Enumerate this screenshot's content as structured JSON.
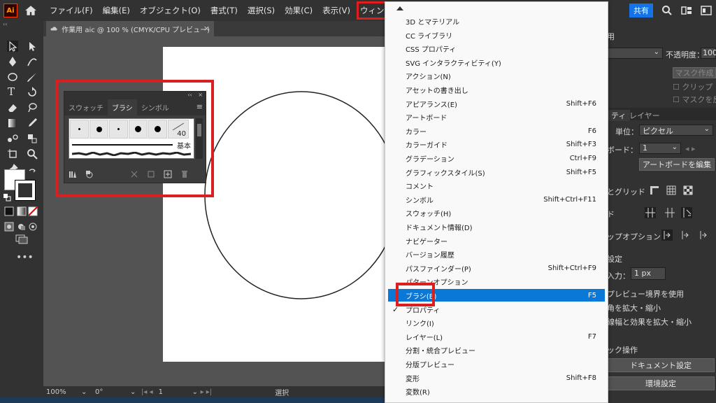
{
  "menubar": {
    "logo": "Ai",
    "items": [
      "ファイル(F)",
      "編集(E)",
      "オブジェクト(O)",
      "書式(T)",
      "選択(S)",
      "効果(C)",
      "表示(V)",
      "ウィンドウ(W)"
    ],
    "share": "共有"
  },
  "document": {
    "tab_label": "作業用 aic @ 100 % (CMYK/CPU プレビュー)",
    "close": "×"
  },
  "brush_panel": {
    "collapse": "‹‹",
    "close": "×",
    "tabs": [
      "スウォッチ",
      "ブラシ",
      "シンボル"
    ],
    "menu": "≡",
    "size_label": "40",
    "basic_label": "基本"
  },
  "statusbar": {
    "zoom": "100%",
    "rotation": "0°",
    "artboard": "1",
    "mode": "選択"
  },
  "right_panel": {
    "tab_top": "用",
    "opacity_label": "不透明度：",
    "opacity_value": "100",
    "mask_btn": "マスク作成",
    "clip_label": "クリップ",
    "invert_label": "マスクを反",
    "tab_props": "ティ",
    "tab_layers": "レイヤー",
    "unit_label": "単位：",
    "unit_value": "ピクセル",
    "artboard_label": "ボード：",
    "artboard_value": "1",
    "edit_artboard_btn": "アートボードを編集",
    "guide_label": "とグリッド",
    "snap_label": "ド",
    "snap_options_label": "ップオプション",
    "prefs_label": "設定",
    "input_label": "入力：",
    "input_value": "1 px",
    "preview_bounds": "プレビュー境界を使用",
    "scale_corners": "角を拡大・縮小",
    "scale_strokes": "線幅と効果を拡大・縮小",
    "quick_ops": "ック操作",
    "doc_settings_btn": "ドキュメント設定",
    "env_settings_btn": "環境設定"
  },
  "dropdown": {
    "items": [
      {
        "label": "3D とマテリアル",
        "shortcut": ""
      },
      {
        "label": "CC ライブラリ",
        "shortcut": ""
      },
      {
        "label": "CSS プロパティ",
        "shortcut": ""
      },
      {
        "label": "SVG インタラクティビティ(Y)",
        "shortcut": ""
      },
      {
        "label": "アクション(N)",
        "shortcut": ""
      },
      {
        "label": "アセットの書き出し",
        "shortcut": ""
      },
      {
        "label": "アピアランス(E)",
        "shortcut": "Shift+F6"
      },
      {
        "label": "アートボード",
        "shortcut": ""
      },
      {
        "label": "カラー",
        "shortcut": "F6"
      },
      {
        "label": "カラーガイド",
        "shortcut": "Shift+F3"
      },
      {
        "label": "グラデーション",
        "shortcut": "Ctrl+F9"
      },
      {
        "label": "グラフィックスタイル(S)",
        "shortcut": "Shift+F5"
      },
      {
        "label": "コメント",
        "shortcut": ""
      },
      {
        "label": "シンボル",
        "shortcut": "Shift+Ctrl+F11"
      },
      {
        "label": "スウォッチ(H)",
        "shortcut": ""
      },
      {
        "label": "ドキュメント情報(D)",
        "shortcut": ""
      },
      {
        "label": "ナビゲーター",
        "shortcut": ""
      },
      {
        "label": "バージョン履歴",
        "shortcut": ""
      },
      {
        "label": "パスファインダー(P)",
        "shortcut": "Shift+Ctrl+F9"
      },
      {
        "label": "パターンオプション",
        "shortcut": ""
      },
      {
        "label": "ブラシ(B)",
        "shortcut": "F5"
      },
      {
        "label": "プロパティ",
        "shortcut": ""
      },
      {
        "label": "リンク(I)",
        "shortcut": ""
      },
      {
        "label": "レイヤー(L)",
        "shortcut": "F7"
      },
      {
        "label": "分割・統合プレビュー",
        "shortcut": ""
      },
      {
        "label": "分版プレビュー",
        "shortcut": ""
      },
      {
        "label": "変形",
        "shortcut": "Shift+F8"
      },
      {
        "label": "変数(R)",
        "shortcut": ""
      }
    ],
    "selected_index": 20,
    "checked_index": 21,
    "checkmark": "✓"
  },
  "colors": {
    "highlight": "#d91f1f",
    "selection": "#0a78d7",
    "share": "#1473e6"
  }
}
